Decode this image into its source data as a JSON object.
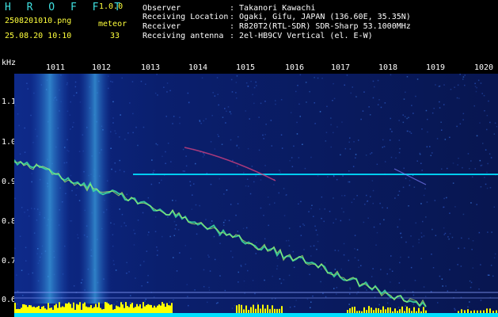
{
  "header": {
    "title": "H R O F F T",
    "version": "1.0.0",
    "filename": "2508201010.png",
    "meteor_label": "meteor",
    "datetime": "25.08.20 10:10",
    "meteor_count": "33"
  },
  "info": [
    {
      "label": "Observer",
      "value": ": Takanori Kawachi"
    },
    {
      "label": "Receiving Location",
      "value": ": Ogaki, Gifu, JAPAN (136.60E, 35.35N)"
    },
    {
      "label": "Receiver",
      "value": ": R820T2(RTL-SDR) SDR-Sharp 53.1000MHz"
    },
    {
      "label": "Receiving antenna",
      "value": ": 2el-HB9CV Vertical (el. E-W)"
    }
  ],
  "axis": {
    "y_unit": "kHz",
    "x_ticks": [
      "1011",
      "1012",
      "1013",
      "1014",
      "1015",
      "1016",
      "1017",
      "1018",
      "1019",
      "1020"
    ],
    "y_ticks": [
      "1.1",
      "1.0",
      "0.9",
      "0.8",
      "0.7",
      "0.6"
    ]
  },
  "colors": {
    "background": "#000000",
    "header_text": "#3fe0e0",
    "accent_text": "#ffff3c",
    "noise": "#1a3fa8",
    "signal": "#40e0a0",
    "meteor_bar": "#ffff00",
    "baseline": "#00e0ff"
  }
}
